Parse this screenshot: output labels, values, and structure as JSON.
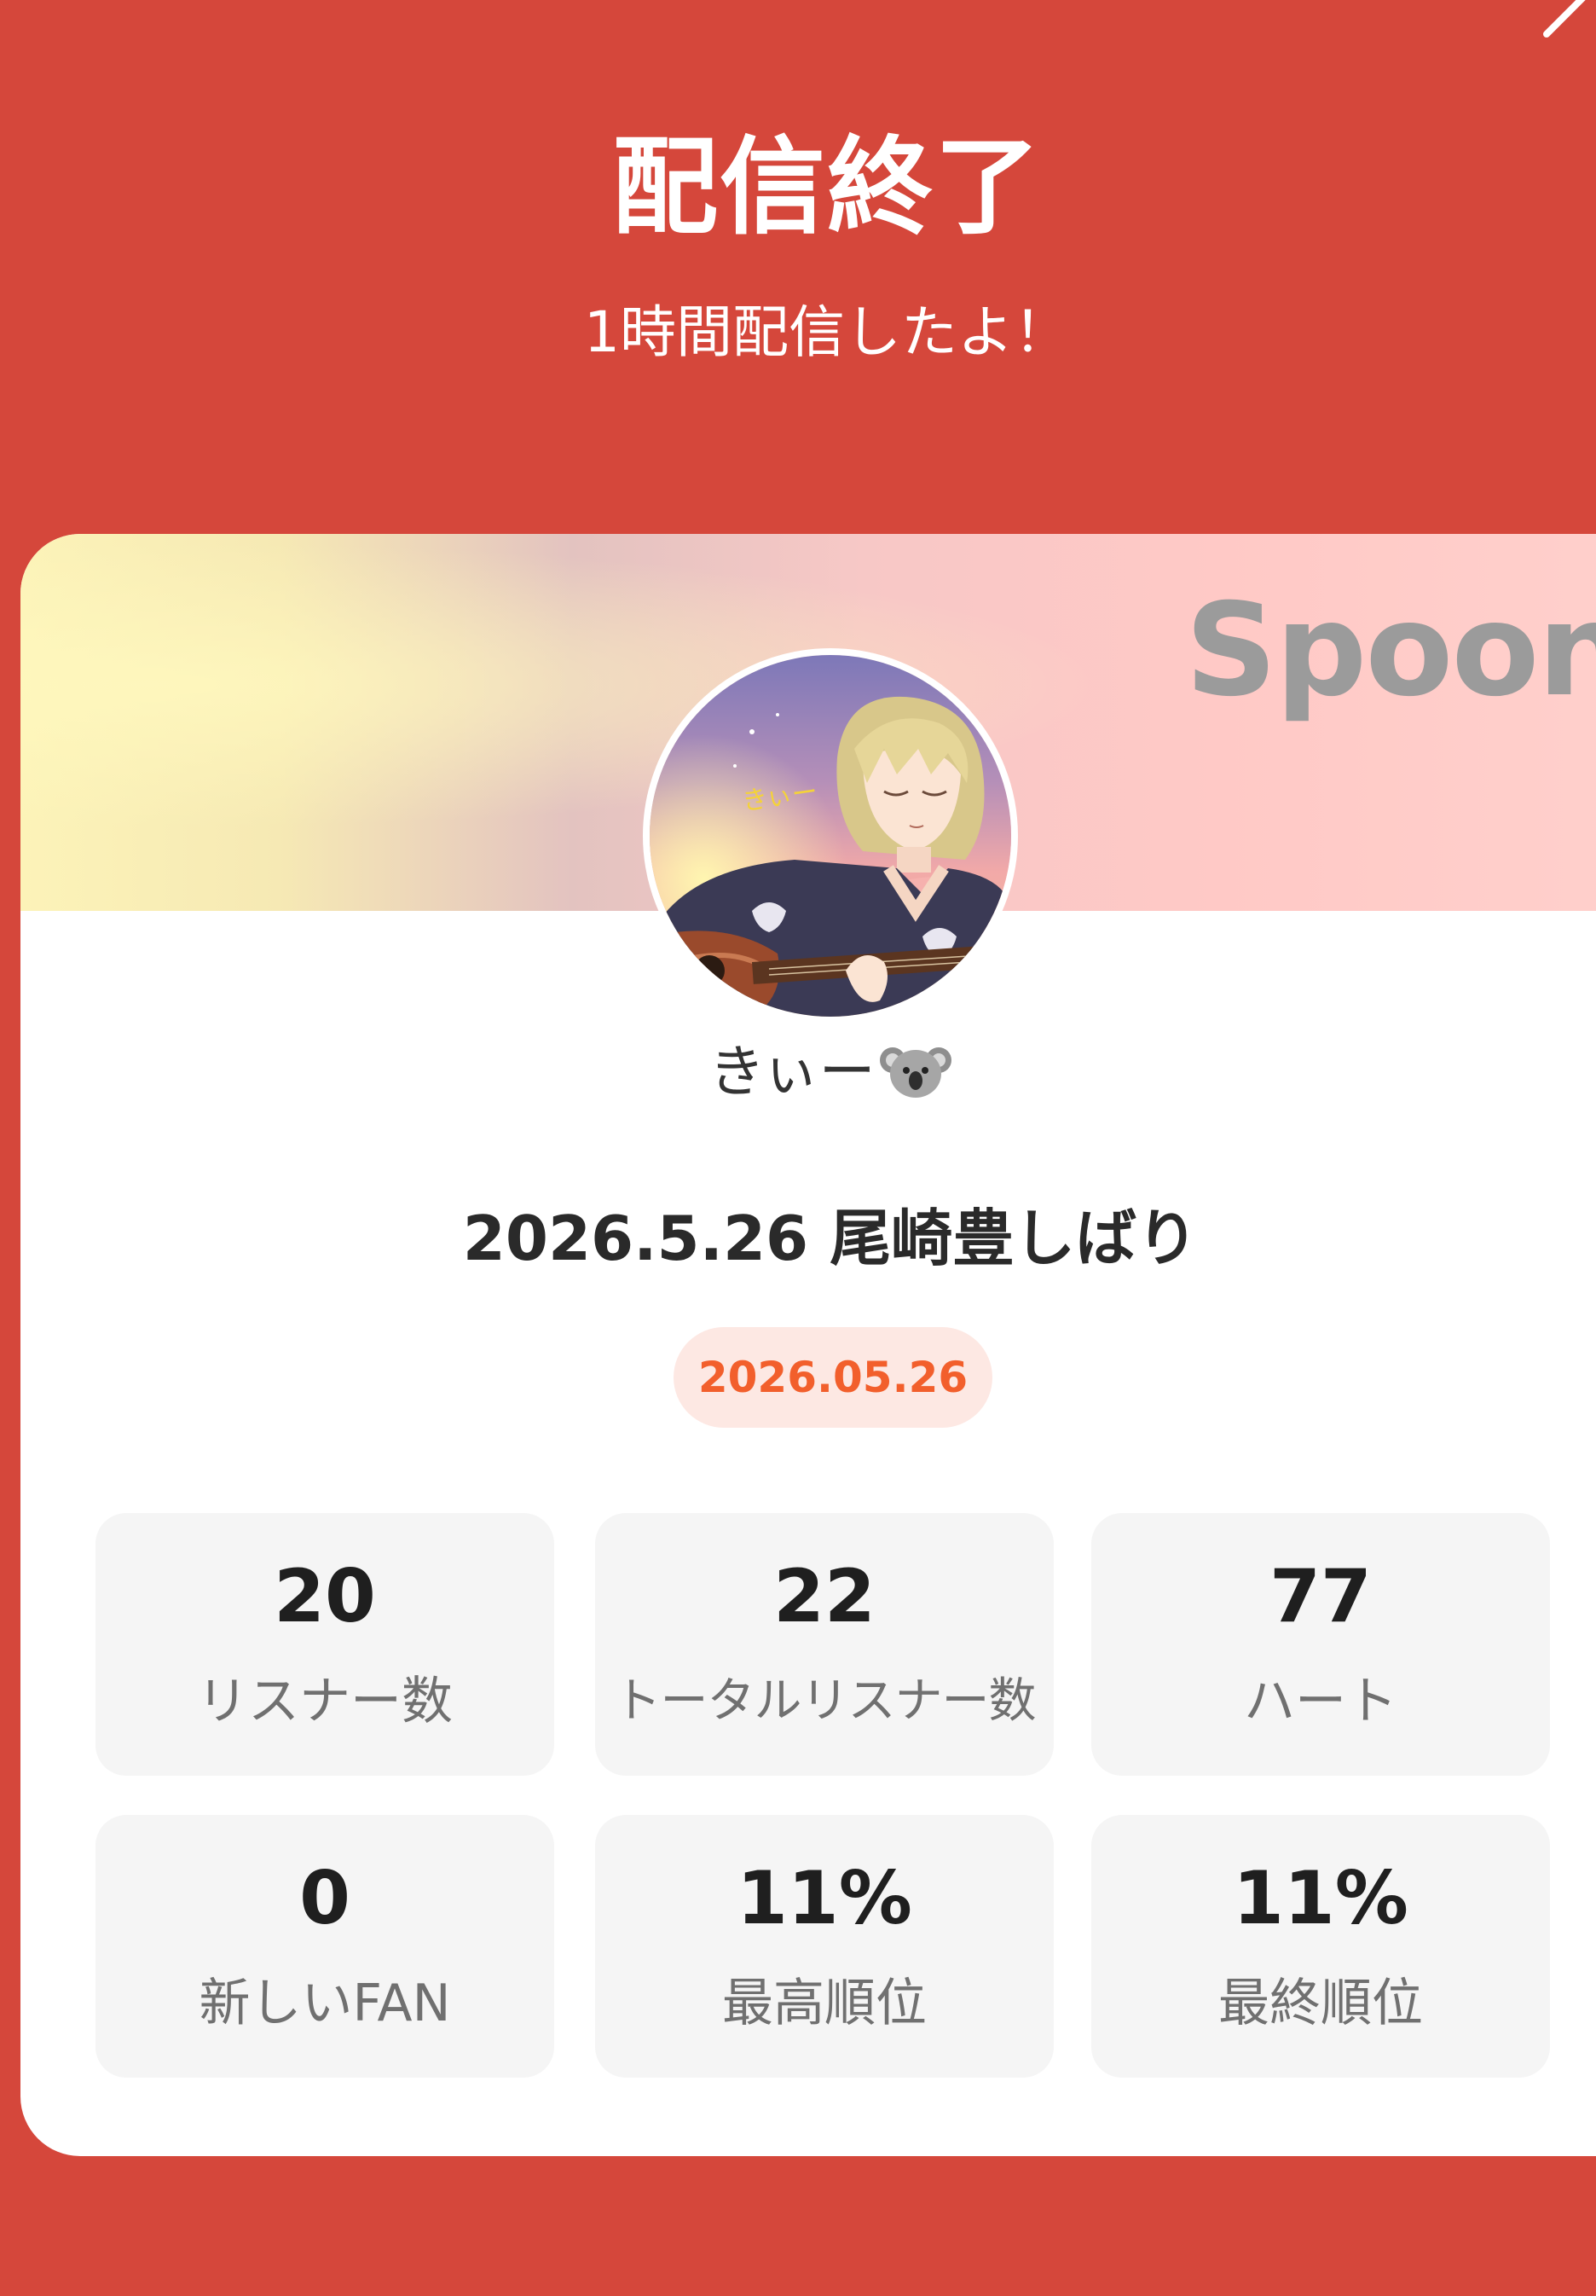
{
  "header": {
    "title": "配信終了",
    "subtitle": "1時間配信したよ！"
  },
  "close_icon": "close-icon",
  "card": {
    "brand": "Spoon",
    "avatar_overlay_text": "きぃー",
    "username": "きぃー",
    "username_emoji_icon": "koala-icon",
    "live_title": "2026.5.26 尾崎豊しばり",
    "date": "2026.05.26",
    "stats": [
      {
        "value": "20",
        "label": "リスナー数"
      },
      {
        "value": "22",
        "label": "トータルリスナー数"
      },
      {
        "value": "77",
        "label": "ハート"
      },
      {
        "value": "0",
        "label": "新しいFAN"
      },
      {
        "value": "11%",
        "label": "最高順位"
      },
      {
        "value": "11%",
        "label": "最終順位"
      }
    ]
  },
  "colors": {
    "background": "#d5473b",
    "card": "#ffffff",
    "stat_box": "#f5f5f5",
    "date_pill_bg": "#fde8e3",
    "date_pill_text": "#f25f2c",
    "brand_text": "#9b9b9b"
  }
}
